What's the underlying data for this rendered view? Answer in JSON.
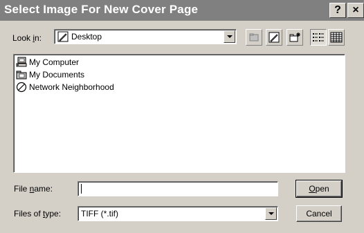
{
  "window": {
    "title": "Select Image For New Cover Page",
    "help_label": "?",
    "close_label": "×"
  },
  "look_in": {
    "label_pre": "Look ",
    "label_key": "i",
    "label_post": "n:",
    "value": "Desktop"
  },
  "toolbar": {
    "buttons": [
      "up-one-level",
      "desktop",
      "new-folder",
      "list-view",
      "details-view"
    ]
  },
  "file_list": {
    "items": [
      {
        "label": "My Computer",
        "icon": "computer-icon"
      },
      {
        "label": "My Documents",
        "icon": "documents-folder-icon"
      },
      {
        "label": "Network Neighborhood",
        "icon": "network-icon"
      }
    ]
  },
  "file_name": {
    "label_pre": "File ",
    "label_key": "n",
    "label_post": "ame:",
    "value": ""
  },
  "file_type": {
    "label_pre": "Files of ",
    "label_key": "t",
    "label_post": "ype:",
    "value": "TIFF (*.tif)"
  },
  "buttons": {
    "open_key": "O",
    "open_rest": "pen",
    "cancel_label": "Cancel"
  }
}
